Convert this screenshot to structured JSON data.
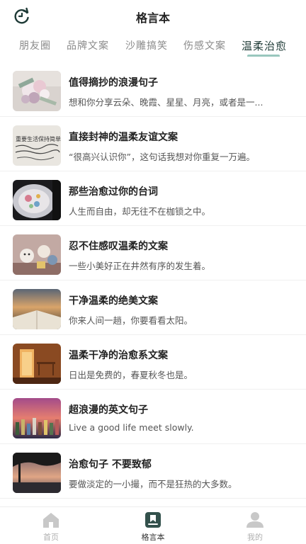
{
  "header": {
    "title": "格言本",
    "refresh_icon": "refresh-icon"
  },
  "tabs": [
    {
      "label": "朋友圈"
    },
    {
      "label": "品牌文案"
    },
    {
      "label": "沙雕搞笑"
    },
    {
      "label": "伤感文案"
    },
    {
      "label": "温柔治愈",
      "active": true
    }
  ],
  "list": [
    {
      "title": "值得摘抄的浪漫句子",
      "desc": "想和你分享云朵、晚霞、星星、月亮，或者是一..."
    },
    {
      "title": "直接封神的温柔友谊文案",
      "desc": "“很高兴认识你”，这句话我想对你重复一万遍。"
    },
    {
      "title": "那些治愈过你的台词",
      "desc": "人生而自由，却无往不在枷锁之中。"
    },
    {
      "title": "忍不住感叹温柔的文案",
      "desc": "一些小美好正在井然有序的发生着。"
    },
    {
      "title": "干净温柔的绝美文案",
      "desc": "你来人间一趟，你要看看太阳。"
    },
    {
      "title": "温柔干净的治愈系文案",
      "desc": "日出是免费的，春夏秋冬也是。"
    },
    {
      "title": "超浪漫的英文句子",
      "desc": "Live a good life meet slowly."
    },
    {
      "title": "治愈句子 不要致郁",
      "desc": "要做淡定的一小撮，而不是狂热的大多数。"
    }
  ],
  "thumb_text": "重要生活保持简单\n不是为了今天",
  "bottom_nav": [
    {
      "label": "首页",
      "icon": "home-icon"
    },
    {
      "label": "格言本",
      "icon": "bookmark-icon",
      "active": true
    },
    {
      "label": "我的",
      "icon": "user-icon"
    }
  ],
  "colors": {
    "accent": "#7fb9ad",
    "active_text": "#1e3a36",
    "inactive_text": "#8a8a8a"
  }
}
